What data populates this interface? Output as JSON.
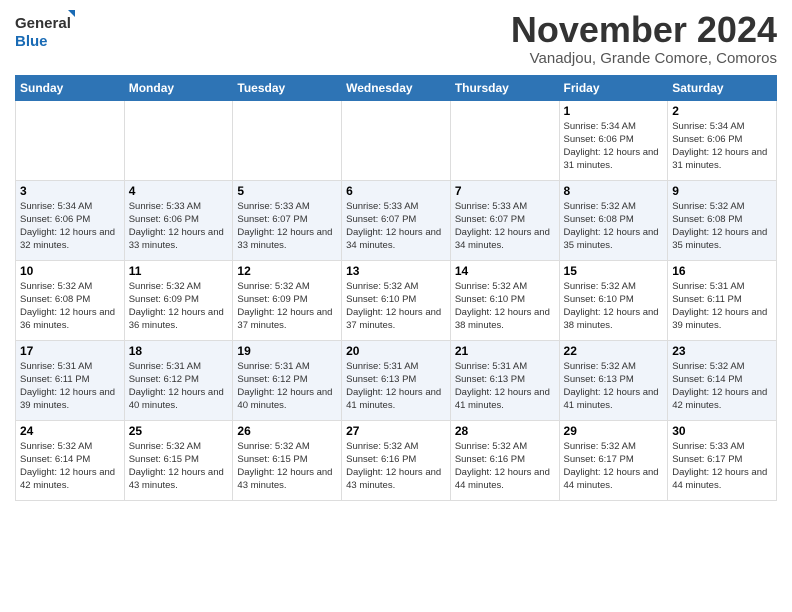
{
  "header": {
    "logo_line1": "General",
    "logo_line2": "Blue",
    "month": "November 2024",
    "location": "Vanadjou, Grande Comore, Comoros"
  },
  "days_of_week": [
    "Sunday",
    "Monday",
    "Tuesday",
    "Wednesday",
    "Thursday",
    "Friday",
    "Saturday"
  ],
  "weeks": [
    [
      {
        "day": "",
        "info": ""
      },
      {
        "day": "",
        "info": ""
      },
      {
        "day": "",
        "info": ""
      },
      {
        "day": "",
        "info": ""
      },
      {
        "day": "",
        "info": ""
      },
      {
        "day": "1",
        "info": "Sunrise: 5:34 AM\nSunset: 6:06 PM\nDaylight: 12 hours and 31 minutes."
      },
      {
        "day": "2",
        "info": "Sunrise: 5:34 AM\nSunset: 6:06 PM\nDaylight: 12 hours and 31 minutes."
      }
    ],
    [
      {
        "day": "3",
        "info": "Sunrise: 5:34 AM\nSunset: 6:06 PM\nDaylight: 12 hours and 32 minutes."
      },
      {
        "day": "4",
        "info": "Sunrise: 5:33 AM\nSunset: 6:06 PM\nDaylight: 12 hours and 33 minutes."
      },
      {
        "day": "5",
        "info": "Sunrise: 5:33 AM\nSunset: 6:07 PM\nDaylight: 12 hours and 33 minutes."
      },
      {
        "day": "6",
        "info": "Sunrise: 5:33 AM\nSunset: 6:07 PM\nDaylight: 12 hours and 34 minutes."
      },
      {
        "day": "7",
        "info": "Sunrise: 5:33 AM\nSunset: 6:07 PM\nDaylight: 12 hours and 34 minutes."
      },
      {
        "day": "8",
        "info": "Sunrise: 5:32 AM\nSunset: 6:08 PM\nDaylight: 12 hours and 35 minutes."
      },
      {
        "day": "9",
        "info": "Sunrise: 5:32 AM\nSunset: 6:08 PM\nDaylight: 12 hours and 35 minutes."
      }
    ],
    [
      {
        "day": "10",
        "info": "Sunrise: 5:32 AM\nSunset: 6:08 PM\nDaylight: 12 hours and 36 minutes."
      },
      {
        "day": "11",
        "info": "Sunrise: 5:32 AM\nSunset: 6:09 PM\nDaylight: 12 hours and 36 minutes."
      },
      {
        "day": "12",
        "info": "Sunrise: 5:32 AM\nSunset: 6:09 PM\nDaylight: 12 hours and 37 minutes."
      },
      {
        "day": "13",
        "info": "Sunrise: 5:32 AM\nSunset: 6:10 PM\nDaylight: 12 hours and 37 minutes."
      },
      {
        "day": "14",
        "info": "Sunrise: 5:32 AM\nSunset: 6:10 PM\nDaylight: 12 hours and 38 minutes."
      },
      {
        "day": "15",
        "info": "Sunrise: 5:32 AM\nSunset: 6:10 PM\nDaylight: 12 hours and 38 minutes."
      },
      {
        "day": "16",
        "info": "Sunrise: 5:31 AM\nSunset: 6:11 PM\nDaylight: 12 hours and 39 minutes."
      }
    ],
    [
      {
        "day": "17",
        "info": "Sunrise: 5:31 AM\nSunset: 6:11 PM\nDaylight: 12 hours and 39 minutes."
      },
      {
        "day": "18",
        "info": "Sunrise: 5:31 AM\nSunset: 6:12 PM\nDaylight: 12 hours and 40 minutes."
      },
      {
        "day": "19",
        "info": "Sunrise: 5:31 AM\nSunset: 6:12 PM\nDaylight: 12 hours and 40 minutes."
      },
      {
        "day": "20",
        "info": "Sunrise: 5:31 AM\nSunset: 6:13 PM\nDaylight: 12 hours and 41 minutes."
      },
      {
        "day": "21",
        "info": "Sunrise: 5:31 AM\nSunset: 6:13 PM\nDaylight: 12 hours and 41 minutes."
      },
      {
        "day": "22",
        "info": "Sunrise: 5:32 AM\nSunset: 6:13 PM\nDaylight: 12 hours and 41 minutes."
      },
      {
        "day": "23",
        "info": "Sunrise: 5:32 AM\nSunset: 6:14 PM\nDaylight: 12 hours and 42 minutes."
      }
    ],
    [
      {
        "day": "24",
        "info": "Sunrise: 5:32 AM\nSunset: 6:14 PM\nDaylight: 12 hours and 42 minutes."
      },
      {
        "day": "25",
        "info": "Sunrise: 5:32 AM\nSunset: 6:15 PM\nDaylight: 12 hours and 43 minutes."
      },
      {
        "day": "26",
        "info": "Sunrise: 5:32 AM\nSunset: 6:15 PM\nDaylight: 12 hours and 43 minutes."
      },
      {
        "day": "27",
        "info": "Sunrise: 5:32 AM\nSunset: 6:16 PM\nDaylight: 12 hours and 43 minutes."
      },
      {
        "day": "28",
        "info": "Sunrise: 5:32 AM\nSunset: 6:16 PM\nDaylight: 12 hours and 44 minutes."
      },
      {
        "day": "29",
        "info": "Sunrise: 5:32 AM\nSunset: 6:17 PM\nDaylight: 12 hours and 44 minutes."
      },
      {
        "day": "30",
        "info": "Sunrise: 5:33 AM\nSunset: 6:17 PM\nDaylight: 12 hours and 44 minutes."
      }
    ]
  ]
}
